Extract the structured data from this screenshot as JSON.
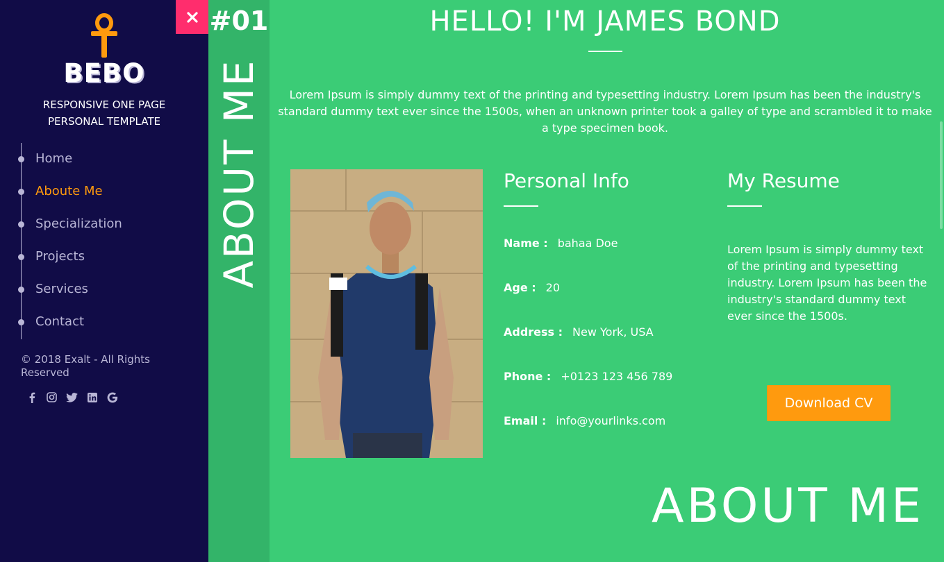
{
  "brand": {
    "name": "BEBO",
    "tagline_line1": "RESPONSIVE ONE PAGE",
    "tagline_line2": "PERSONAL TEMPLATE"
  },
  "nav": [
    {
      "label": "Home"
    },
    {
      "label": "Aboute Me"
    },
    {
      "label": "Specialization"
    },
    {
      "label": "Projects"
    },
    {
      "label": "Services"
    },
    {
      "label": "Contact"
    }
  ],
  "active_nav": "Aboute Me",
  "copyright": "© 2018 Exalt - All Rights Reserved",
  "social_icons": [
    "facebook-icon",
    "instagram-icon",
    "twitter-icon",
    "linkedin-icon",
    "google-icon"
  ],
  "section": {
    "number": "#01",
    "vertical_title": "ABOUT ME",
    "big_title": "ABOUT ME"
  },
  "main": {
    "title": "HELLO! I'M JAMES BOND",
    "intro": "Lorem Ipsum is simply dummy text of the printing and typesetting industry. Lorem Ipsum has been the industry's standard dummy text ever since the 1500s, when an unknown printer took a galley of type and scrambled it to make a type specimen book."
  },
  "personal_info": {
    "heading": "Personal Info",
    "rows": [
      {
        "key": "Name :",
        "value": "bahaa Doe"
      },
      {
        "key": "Age :",
        "value": "20"
      },
      {
        "key": "Address :",
        "value": "New York, USA"
      },
      {
        "key": "Phone :",
        "value": "+0123 123 456 789"
      },
      {
        "key": "Email :",
        "value": "info@yourlinks.com"
      }
    ]
  },
  "resume": {
    "heading": "My Resume",
    "text": "Lorem Ipsum is simply dummy text of the printing and typesetting industry. Lorem Ipsum has been the industry's standard dummy text ever since the 1500s.",
    "button": "Download CV"
  },
  "colors": {
    "sidebar": "#110c47",
    "main": "#3bcc76",
    "strip": "#33b469",
    "accent": "#ff9a0e",
    "close": "#ff2d6d",
    "nav_text": "#b9b6d6"
  }
}
